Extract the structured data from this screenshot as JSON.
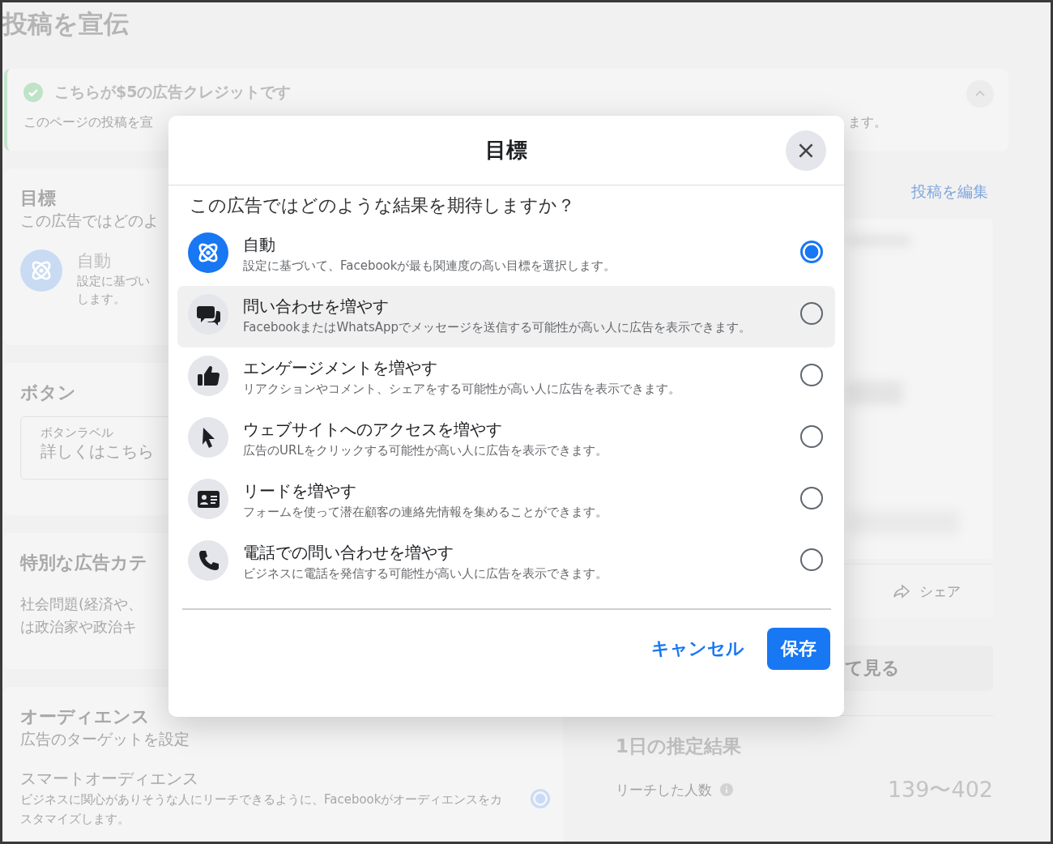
{
  "page": {
    "title": "投稿を宣伝"
  },
  "banner": {
    "title": "こちらが$5の広告クレジットです",
    "text_left": "このページの投稿を宣",
    "text_right": "ます。"
  },
  "objective_card": {
    "title": "目標",
    "subtitle": "この広告ではどのよ",
    "option_title": "自動",
    "option_lines": [
      "設定に基づい",
      "します。"
    ]
  },
  "button_card": {
    "title": "ボタン",
    "field": {
      "label": "ボタンラベル",
      "value": "詳しくはこちら"
    }
  },
  "special_category_card": {
    "title": "特別な広告カテ",
    "lines": [
      "社会問題(経済や、",
      "は政治家や政治キ"
    ]
  },
  "audience_card": {
    "title": "オーディエンス",
    "subtitle": "広告のターゲットを設定",
    "option": {
      "title": "スマートオーディエンス",
      "text": "ビジネスに関心がありそうな人にリーチできるように、Facebookがオーディエンスをカスタマイズします。",
      "selected": true
    }
  },
  "preview": {
    "edit_link": "投稿を編集",
    "share": "シェア",
    "see_all": "て見る"
  },
  "estimate": {
    "title": "1日の推定結果",
    "reach_label": "リーチした人数",
    "reach_value": "139〜402"
  },
  "dialog": {
    "title": "目標",
    "question": "この広告ではどのような結果を期待しますか？",
    "options": [
      {
        "kind": "atom",
        "title": "自動",
        "text": "設定に基づいて、Facebookが最も関連度の高い目標を選択します。",
        "selected": true,
        "highlighted": false
      },
      {
        "kind": "chat",
        "title": "問い合わせを増やす",
        "text": "FacebookまたはWhatsAppでメッセージを送信する可能性が高い人に広告を表示できます。",
        "selected": false,
        "highlighted": true
      },
      {
        "kind": "thumb",
        "title": "エンゲージメントを増やす",
        "text": "リアクションやコメント、シェアをする可能性が高い人に広告を表示できます。",
        "selected": false,
        "highlighted": false
      },
      {
        "kind": "cursor",
        "title": "ウェブサイトへのアクセスを増やす",
        "text": "広告のURLをクリックする可能性が高い人に広告を表示できます。",
        "selected": false,
        "highlighted": false
      },
      {
        "kind": "card",
        "title": "リードを増やす",
        "text": "フォームを使って潜在顧客の連絡先情報を集めることができます。",
        "selected": false,
        "highlighted": false
      },
      {
        "kind": "phone",
        "title": "電話での問い合わせを増やす",
        "text": "ビジネスに電話を発信する可能性が高い人に広告を表示できます。",
        "selected": false,
        "highlighted": false
      }
    ],
    "cancel": "キャンセル",
    "save": "保存"
  }
}
